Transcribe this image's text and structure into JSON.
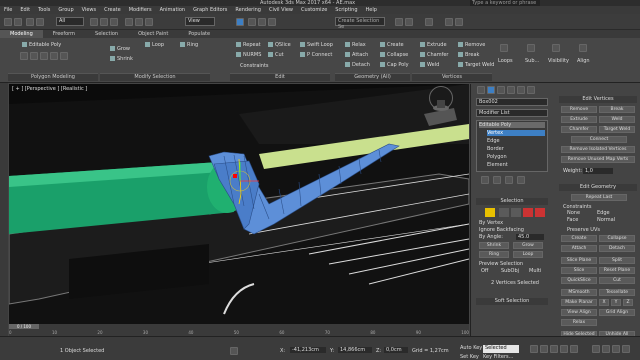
{
  "window": {
    "title": "Autodesk 3ds Max 2017 x64 - AE.max",
    "search_placeholder": "Type a keyword or phrase"
  },
  "menu": [
    "File",
    "Edit",
    "Tools",
    "Group",
    "Views",
    "Create",
    "Modifiers",
    "Animation",
    "Graph Editors",
    "Rendering",
    "Civil View",
    "Customize",
    "Scripting",
    "Help"
  ],
  "toolbar": {
    "selection_filter": "All",
    "view": "View",
    "selection_set": "Create Selection Se"
  },
  "ribbon": {
    "tabs": [
      "Modeling",
      "Freeform",
      "Selection",
      "Object Paint",
      "Populate"
    ],
    "groups": [
      "Polygon Modeling",
      "Modify Selection",
      "Edit",
      "Geometry (All)",
      "Vertices",
      "Loops",
      "Subdivision",
      "Visibility",
      "Align"
    ],
    "editable_poly": "Editable Poly",
    "modify_selection": [
      "Grow",
      "Shrink",
      "Loop",
      "Ring"
    ],
    "edit": [
      "Repeat",
      "QSlice",
      "Swift Loop",
      "NURMS",
      "Cut",
      "P Connect",
      "Constraints"
    ],
    "geometry": [
      "Relax",
      "Create",
      "Attach",
      "Collapse",
      "Detach",
      "Cap Poly"
    ],
    "vertices": [
      "Extrude",
      "Remove",
      "Chamfer",
      "Break",
      "Weld",
      "Target Weld"
    ],
    "right": [
      "Loops",
      "Sub...",
      "Visibility",
      "Align"
    ]
  },
  "viewport": {
    "label": "[ + ] [Perspective ] [Realistic ]"
  },
  "command_panel": {
    "object_name": "Box002",
    "modifier_list": "Modifier List",
    "stack": [
      "Editable Poly",
      "Vertex",
      "Edge",
      "Border",
      "Polygon",
      "Element"
    ],
    "selection": {
      "title": "Selection",
      "by_vertex": "By Vertex",
      "ignore_backfacing": "Ignore Backfacing",
      "by_angle": "By Angle:",
      "angle": "45.0",
      "shrink": "Shrink",
      "grow": "Grow",
      "ring": "Ring",
      "loop": "Loop",
      "preview": "Preview Selection",
      "preview_options": [
        "Off",
        "SubObj",
        "Multi"
      ],
      "status": "2 Vertices Selected"
    },
    "soft_selection": "Soft Selection",
    "edit_vertices": {
      "title": "Edit Vertices",
      "buttons": [
        "Remove",
        "Break",
        "Extrude",
        "Weld",
        "Chamfer",
        "Target Weld",
        "Connect",
        "Remove Isolated Vertices",
        "Remove Unused Map Verts"
      ],
      "weight_label": "Weight:",
      "weight": "1,0"
    },
    "edit_geometry": {
      "title": "Edit Geometry",
      "repeat_last": "Repeat Last",
      "constraints": "Constraints",
      "constraint_options": [
        "None",
        "Edge",
        "Face",
        "Normal"
      ],
      "preserve_uvs": "Preserve UVs",
      "buttons": [
        "Create",
        "Collapse",
        "Attach",
        "Detach",
        "Slice Plane",
        "Split",
        "Slice",
        "Reset Plane",
        "QuickSlice",
        "Cut",
        "MSmooth",
        "Tessellate",
        "Make Planar",
        "X",
        "Y",
        "Z",
        "View Align",
        "Grid Align",
        "Relax",
        "Hide Selected",
        "Unhide All"
      ]
    }
  },
  "timeline": {
    "frame": "0 / 100",
    "ticks": [
      "0",
      "10",
      "20",
      "30",
      "40",
      "50",
      "60",
      "70",
      "80",
      "90",
      "100"
    ]
  },
  "status": {
    "objects": "1 Object Selected",
    "x": "-41,213cm",
    "y": "14,866cm",
    "z": "0,0cm",
    "grid": "Grid = 1,27cm",
    "autokey": "Auto Key",
    "set_key": "Set Key",
    "selected": "Selected",
    "key_filters": "Key Filters..."
  }
}
